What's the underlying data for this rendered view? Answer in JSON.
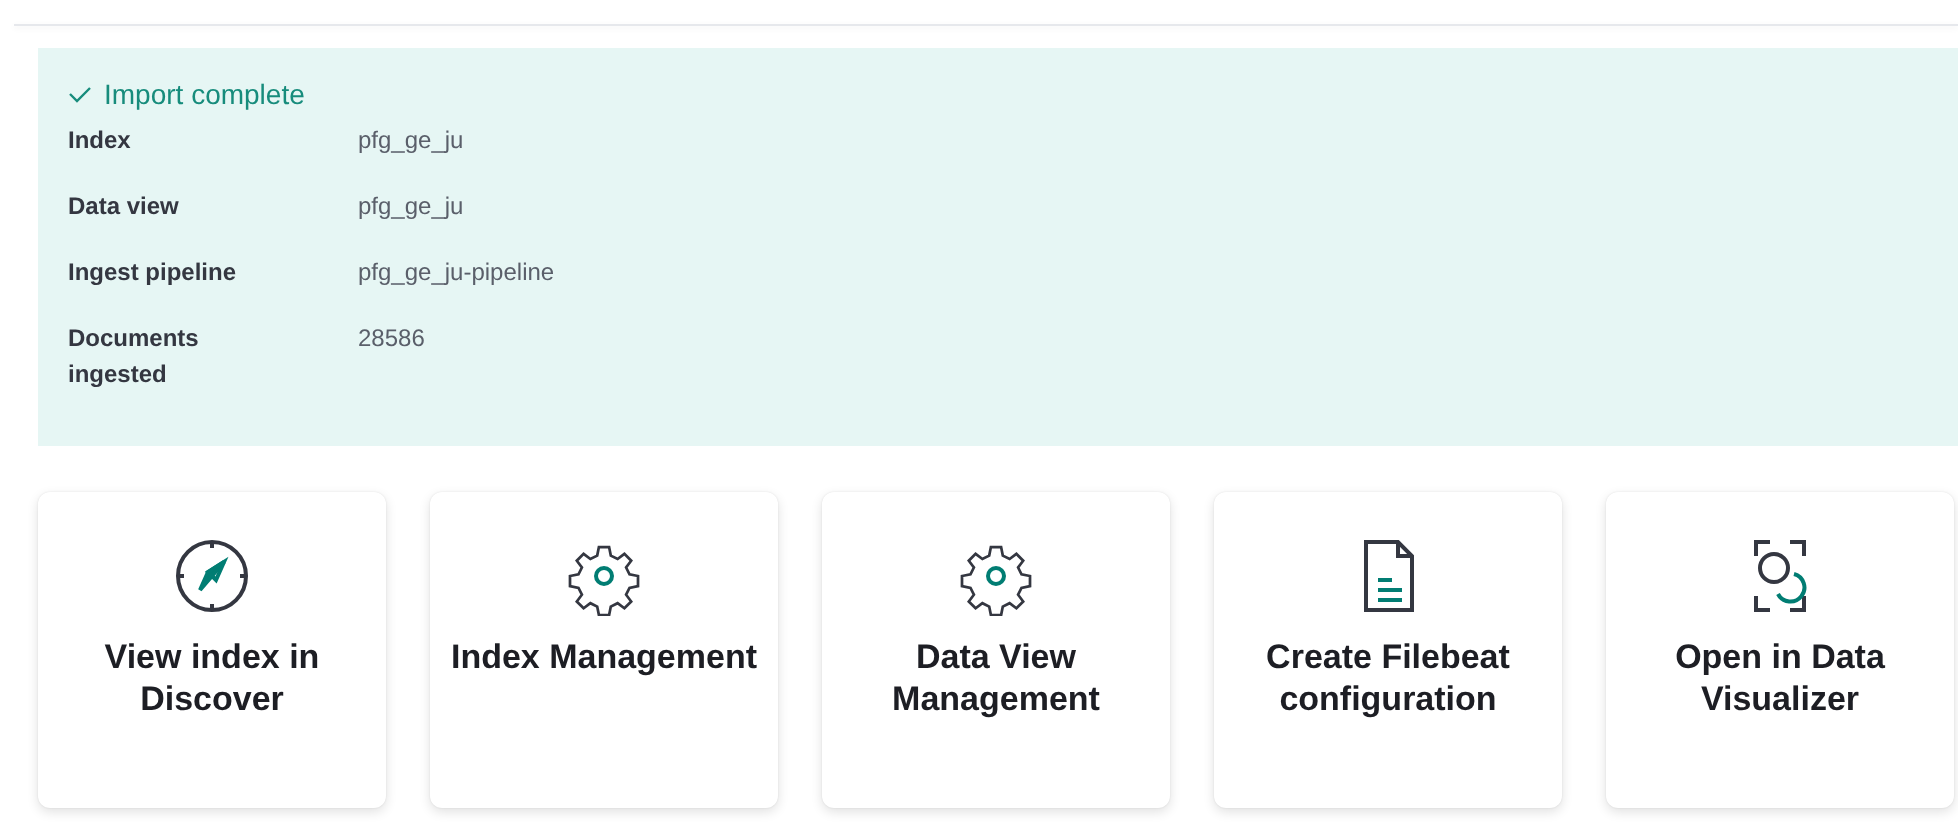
{
  "callout": {
    "title": "Import complete",
    "rows": [
      {
        "label": "Index",
        "value": "pfg_ge_ju"
      },
      {
        "label": "Data view",
        "value": "pfg_ge_ju"
      },
      {
        "label": "Ingest pipeline",
        "value": "pfg_ge_ju-pipeline"
      },
      {
        "label": "Documents ingested",
        "value": "28586"
      }
    ]
  },
  "cards": [
    {
      "kind": "compass",
      "title": "View index in Discover"
    },
    {
      "kind": "gear",
      "title": "Index Management"
    },
    {
      "kind": "gear",
      "title": "Data View Management"
    },
    {
      "kind": "document",
      "title": "Create Filebeat configuration"
    },
    {
      "kind": "visualizer",
      "title": "Open in Data Visualizer"
    }
  ]
}
